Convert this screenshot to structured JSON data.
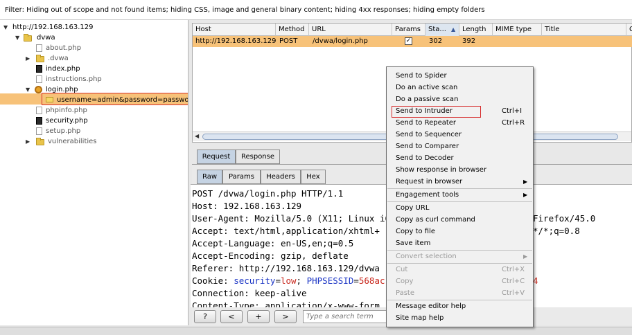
{
  "filter_bar": {
    "text": "Filter:  Hiding out of scope and not found items;  hiding CSS, image and general binary content;  hiding 4xx responses;  hiding empty folders"
  },
  "site_tree": {
    "root": "http://192.168.163.129",
    "items": [
      {
        "label": "dvwa",
        "type": "folder"
      },
      {
        "label": "about.php",
        "type": "file"
      },
      {
        "label": ".dvwa",
        "type": "folder"
      },
      {
        "label": "index.php",
        "type": "file"
      },
      {
        "label": "instructions.php",
        "type": "file"
      },
      {
        "label": "login.php",
        "type": "gear"
      },
      {
        "label": "username=admin&password=passwo",
        "type": "params",
        "selected": true
      },
      {
        "label": "phpinfo.php",
        "type": "file"
      },
      {
        "label": "security.php",
        "type": "file"
      },
      {
        "label": "setup.php",
        "type": "file"
      },
      {
        "label": "vulnerabilities",
        "type": "folder"
      }
    ]
  },
  "history_table": {
    "columns": [
      "Host",
      "Method",
      "URL",
      "Params",
      "Sta...",
      "Length",
      "MIME type",
      "Title",
      "C"
    ],
    "sort_indicator": "▲",
    "rows": [
      {
        "host": "http://192.168.163.129",
        "method": "POST",
        "url": "/dvwa/login.php",
        "params": true,
        "status": "302",
        "length": "392"
      }
    ]
  },
  "tabs": {
    "main": [
      "Request",
      "Response"
    ],
    "sub": [
      "Raw",
      "Params",
      "Headers",
      "Hex"
    ]
  },
  "request_raw": {
    "line1": "POST /dvwa/login.php HTTP/1.1",
    "host_key": "Host:",
    "host_val": "192.168.163.129",
    "ua_key": "User-Agent:",
    "ua_val": "Mozilla/5.0 (X11; Linux i6",
    "ua_tail": "Firefox/45.0",
    "accept_key": "Accept:",
    "accept_val": "text/html,application/xhtml+",
    "accept_tail": "*/*;q=0.8",
    "lang_key": "Accept-Language:",
    "lang_val": "en-US,en;q=0.5",
    "enc_key": "Accept-Encoding:",
    "enc_val": "gzip, deflate",
    "ref_key": "Referer:",
    "ref_val": "http://192.168.163.129/dvwa",
    "cookie_key": "Cookie:",
    "cookie_p1": "security",
    "cookie_eq1": "=",
    "cookie_v1": "low",
    "cookie_semi": ";",
    "cookie_p2": "PHPSESSID",
    "cookie_eq2": "=",
    "cookie_v2": "568ac",
    "cookie_tail": "4",
    "conn_key": "Connection:",
    "conn_val": "keep-alive",
    "ct_key": "Content-Type:",
    "ct_val": "application/x-www-form"
  },
  "bottom_bar": {
    "help_label": "?",
    "prev_label": "<",
    "add_label": "+",
    "next_label": ">",
    "search_placeholder": "Type a search term"
  },
  "context_menu": {
    "items": [
      {
        "label": "Send to Spider"
      },
      {
        "label": "Do an active scan"
      },
      {
        "label": "Do a passive scan"
      },
      {
        "label": "Send to Intruder",
        "shortcut": "Ctrl+I"
      },
      {
        "label": "Send to Repeater",
        "shortcut": "Ctrl+R"
      },
      {
        "label": "Send to Sequencer"
      },
      {
        "label": "Send to Comparer"
      },
      {
        "label": "Send to Decoder"
      },
      {
        "label": "Show response in browser"
      },
      {
        "label": "Request in browser"
      },
      {
        "label": "Engagement tools"
      },
      {
        "label": "Copy URL"
      },
      {
        "label": "Copy as curl command"
      },
      {
        "label": "Copy to file"
      },
      {
        "label": "Save item"
      },
      {
        "label": "Convert selection"
      },
      {
        "label": "Cut",
        "shortcut": "Ctrl+X"
      },
      {
        "label": "Copy",
        "shortcut": "Ctrl+C"
      },
      {
        "label": "Paste",
        "shortcut": "Ctrl+V"
      },
      {
        "label": "Message editor help"
      },
      {
        "label": "Site map help"
      }
    ]
  },
  "colors": {
    "selection": "#f7c279",
    "highlight_border": "#d62b2b",
    "cookie_blue": "#1b35c5",
    "cookie_red": "#c8261b"
  }
}
